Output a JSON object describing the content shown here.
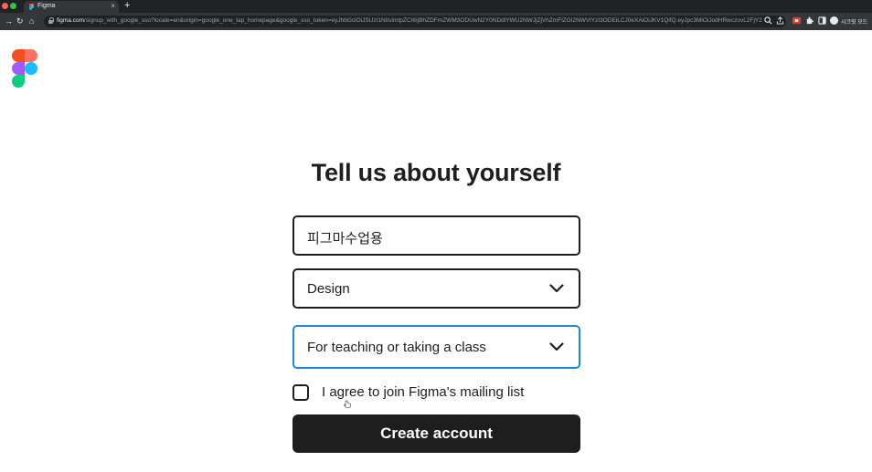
{
  "browser": {
    "tab_title": "Figma",
    "tab_close": "×",
    "new_tab": "+",
    "url_host": "figma.com",
    "url_path": "/signup_with_google_sso?locale=en&origin=google_one_tap_homepage&google_sso_token=eyJhbGciOiJSUzI1NiIsImtpZCI6IjBhZDFmZWM3ODUwN2Y0NDdlYWU2NWJjZjVhZmFlZGI2NWVlYzI3ODEiLCJ0eXAiOiJKV1QifQ.eyJpc3MiOiJodHRwczovL2FjY2",
    "profile_name": "시크릿 모드",
    "nav": {
      "back": "→",
      "reload": "↻",
      "home": "⌂"
    }
  },
  "page": {
    "heading": "Tell us about yourself",
    "name_field_value": "피그마수업용",
    "role_select_value": "Design",
    "purpose_select_value": "For teaching or taking a class",
    "mailing_list_label": "I agree to join Figma's mailing list",
    "mailing_list_checked": false,
    "create_button_label": "Create account"
  },
  "colors": {
    "figma_red": "#f24e1e",
    "figma_orange": "#ff7262",
    "figma_purple": "#a259ff",
    "figma_blue": "#1abcfe",
    "figma_green": "#0acf83",
    "focus_blue": "#1d86e8",
    "text_dark": "#1e1e1e"
  },
  "icons": [
    "figma-logo-icon",
    "chevron-down-icon",
    "lock-icon",
    "reload-icon",
    "home-icon",
    "back-icon",
    "search-icon",
    "share-icon",
    "extensions-icon",
    "sidepanel-icon",
    "cursor-icon"
  ]
}
